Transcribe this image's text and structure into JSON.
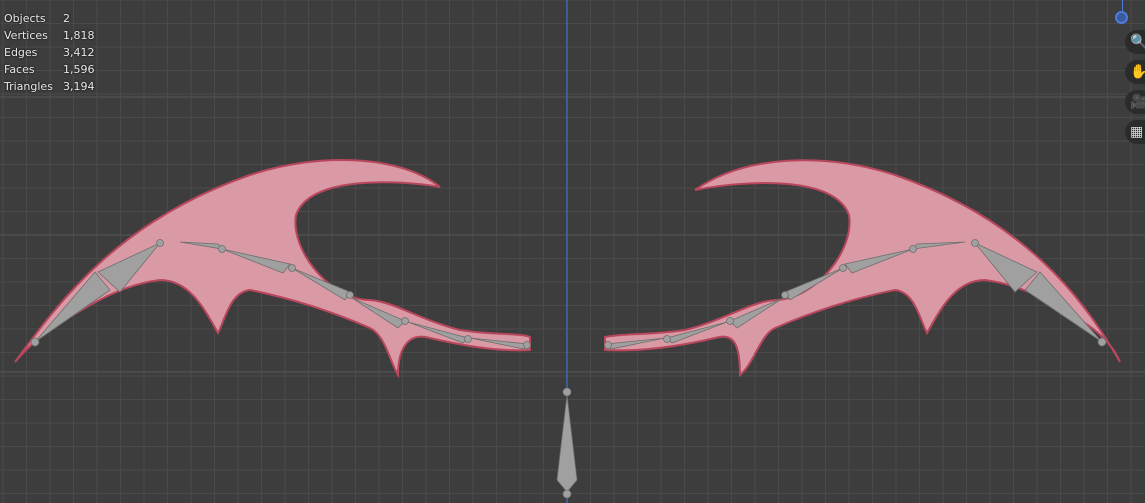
{
  "stats": {
    "rows": [
      {
        "label": "Objects",
        "value": "2"
      },
      {
        "label": "Vertices",
        "value": "1,818"
      },
      {
        "label": "Edges",
        "value": "3,412"
      },
      {
        "label": "Faces",
        "value": "1,596"
      },
      {
        "label": "Triangles",
        "value": "3,194"
      }
    ]
  },
  "navigation": {
    "buttons": [
      {
        "name": "zoom-icon",
        "glyph": "🔍"
      },
      {
        "name": "pan-hand-icon",
        "glyph": "✋"
      },
      {
        "name": "camera-icon",
        "glyph": "🎥"
      },
      {
        "name": "grid-icon",
        "glyph": "▦"
      }
    ]
  },
  "colors": {
    "background": "#3d3d3d",
    "grid_line": "#4a4a4a",
    "grid_major": "#525252",
    "axis_z": "#3f6fd4",
    "wing_fill": "#d99aa5",
    "wing_outline": "#b8475d",
    "bone": "#9a9a9a"
  }
}
